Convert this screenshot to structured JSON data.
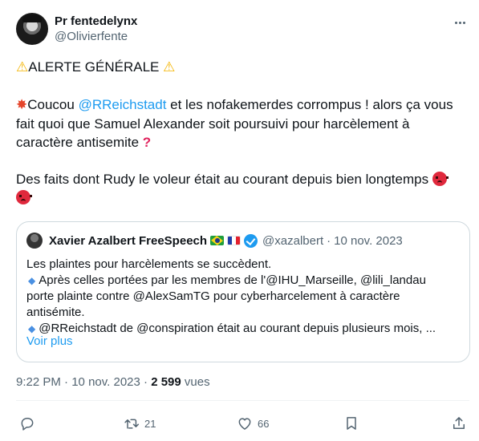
{
  "tweet": {
    "author": {
      "display_name": "Pr fentedelynx",
      "handle": "@Olivierfente"
    },
    "body": {
      "line1_text": "ALERTE GÉNÉRALE",
      "p2_a": "Coucou ",
      "p2_mention": "@RReichstadt",
      "p2_b": " et les nofakemerdes corrompus ! alors ça vous fait quoi que Samuel Alexander soit poursuivi pour harcèlement à caractère antisemite ",
      "p3": "Des faits dont Rudy le voleur était au courant depuis bien longtemps "
    },
    "quote": {
      "display_name": "Xavier Azalbert FreeSpeech",
      "handle": "@xazalbert",
      "dot": "·",
      "date": "10 nov. 2023",
      "line1": "Les plaintes pour harcèlements se succèdent.",
      "line2": "Après celles portées par les membres de l'@IHU_Marseille,  @lili_landau",
      "line3": "porte plainte contre @AlexSamTG pour cyberharcelement à caractère",
      "line4": "antisémite.",
      "line5": "@RReichstadt de @conspiration était au courant depuis plusieurs mois, ...",
      "show_more": "Voir plus"
    },
    "meta": {
      "time": "9:22 PM",
      "sep1": " · ",
      "date": "10 nov. 2023",
      "sep2": " · ",
      "views_count": "2 599",
      "views_label": " vues"
    },
    "actions": {
      "reply_count": "",
      "retweet_count": "21",
      "like_count": "66"
    }
  },
  "icons": {
    "more": "more-horizontal-icon",
    "warning": "warning-emoji",
    "collision": "collision-emoji",
    "question": "red-question-emoji",
    "angry": "angry-face-emoji",
    "diamond": "small-blue-diamond-emoji",
    "reply": "reply-icon",
    "retweet": "retweet-icon",
    "like": "heart-icon",
    "bookmark": "bookmark-icon",
    "share": "share-icon"
  },
  "colors": {
    "accent": "#1d9bf0",
    "text": "#0f1419",
    "secondary": "#536471",
    "border": "#cfd9de"
  }
}
